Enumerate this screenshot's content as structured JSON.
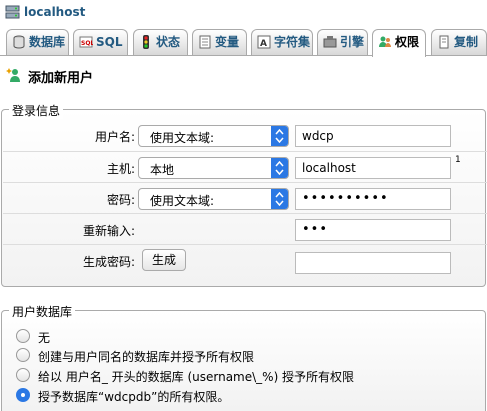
{
  "server": {
    "name": "localhost"
  },
  "tabs": [
    {
      "label": "数据库"
    },
    {
      "label": "SQL"
    },
    {
      "label": "状态"
    },
    {
      "label": "变量"
    },
    {
      "label": "字符集"
    },
    {
      "label": "引擎"
    },
    {
      "label": "权限"
    },
    {
      "label": "复制"
    }
  ],
  "page": {
    "title": "添加新用户"
  },
  "login": {
    "legend": "登录信息",
    "username": {
      "label": "用户名:",
      "select": "使用文本域:",
      "value": "wdcp"
    },
    "host": {
      "label": "主机:",
      "select": "本地",
      "value": "localhost",
      "note": "1"
    },
    "password": {
      "label": "密码:",
      "select": "使用文本域:",
      "value": "••••••••••"
    },
    "retype": {
      "label": "重新输入:",
      "value": "•••"
    },
    "generate": {
      "label": "生成密码:",
      "button": "生成",
      "value": ""
    }
  },
  "db": {
    "legend": "用户数据库",
    "options": [
      {
        "label": "无",
        "checked": false
      },
      {
        "label": "创建与用户同名的数据库并授予所有权限",
        "checked": false
      },
      {
        "label": "给以 用户名_ 开头的数据库 (username\\_%) 授予所有权限",
        "checked": false
      },
      {
        "label": "授予数据库“wdcpdb”的所有权限。",
        "checked": true
      }
    ]
  },
  "colors": {
    "link": "#235a81",
    "accent": "#2b78e4"
  }
}
